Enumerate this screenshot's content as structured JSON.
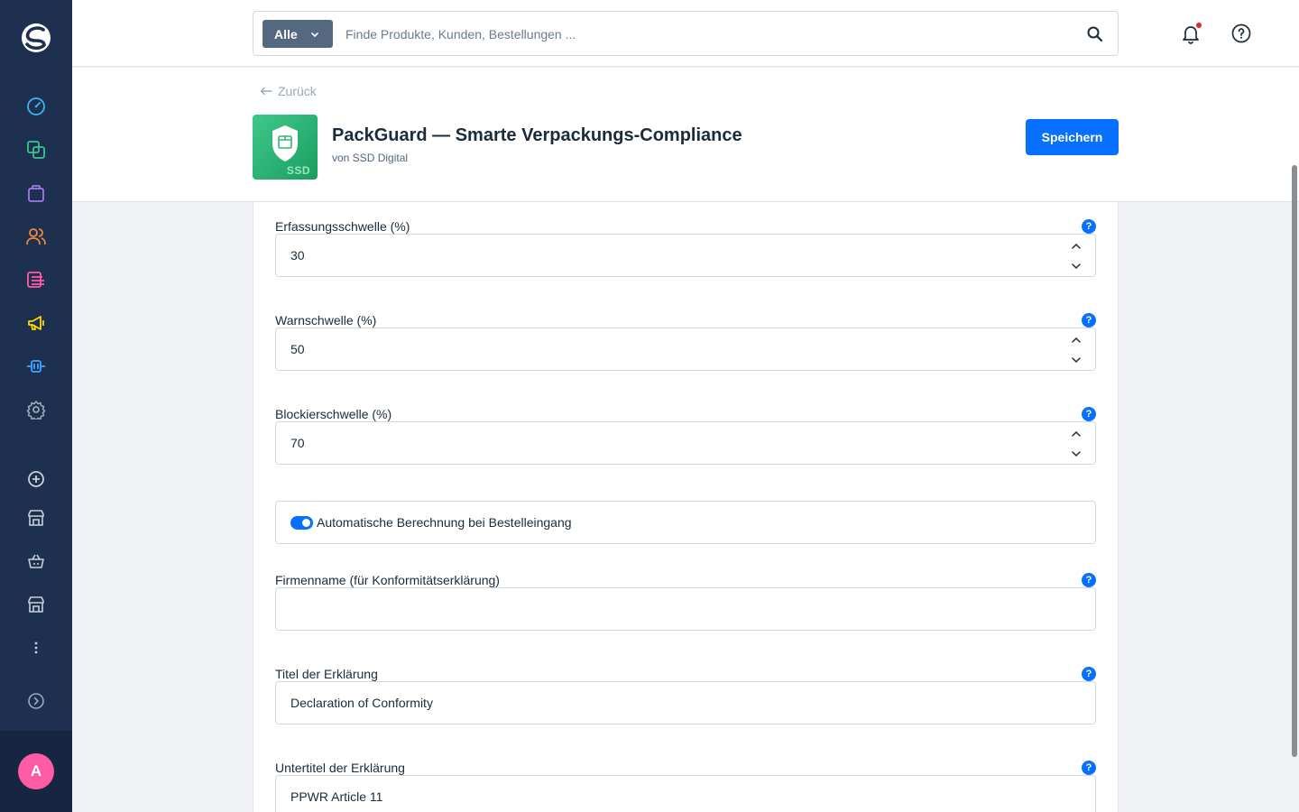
{
  "header": {
    "search_type": "Alle",
    "search_placeholder": "Finde Produkte, Kunden, Bestellungen ..."
  },
  "sidebar": {
    "items": [
      {
        "name": "dashboard",
        "color": "#3fb5f0"
      },
      {
        "name": "catalogues",
        "color": "#3ec28f"
      },
      {
        "name": "orders",
        "color": "#a47ae8"
      },
      {
        "name": "customers",
        "color": "#f28a3a"
      },
      {
        "name": "content",
        "color": "#ff5ca8"
      },
      {
        "name": "marketing",
        "color": "#ffd700"
      },
      {
        "name": "extensions",
        "color": "#3fa6ff"
      },
      {
        "name": "settings",
        "color": "#9aa8b5"
      }
    ],
    "avatar_initial": "A"
  },
  "smartbar": {
    "back_label": "Zurück",
    "app_title": "PackGuard — Smarte Verpackungs-Compliance",
    "app_vendor": "von SSD Digital",
    "app_logo_text": "SSD",
    "save_label": "Speichern"
  },
  "form": {
    "fields": [
      {
        "label": "Erfassungsschwelle (%)",
        "value": "30"
      },
      {
        "label": "Warnschwelle (%)",
        "value": "50"
      },
      {
        "label": "Blockierschwelle (%)",
        "value": "70"
      },
      {
        "label": "Firmenname (für Konformitätserklärung)",
        "value": ""
      },
      {
        "label": "Titel der Erklärung",
        "value": "Declaration of Conformity"
      },
      {
        "label": "Untertitel der Erklärung",
        "value": "PPWR Article 11"
      }
    ],
    "switch_label": "Automatische Berechnung bei Bestelleingang",
    "switch_on": true,
    "help_glyph": "?"
  },
  "colors": {
    "accent": "#0870ff",
    "sidebar_bg": "#1e3050"
  }
}
